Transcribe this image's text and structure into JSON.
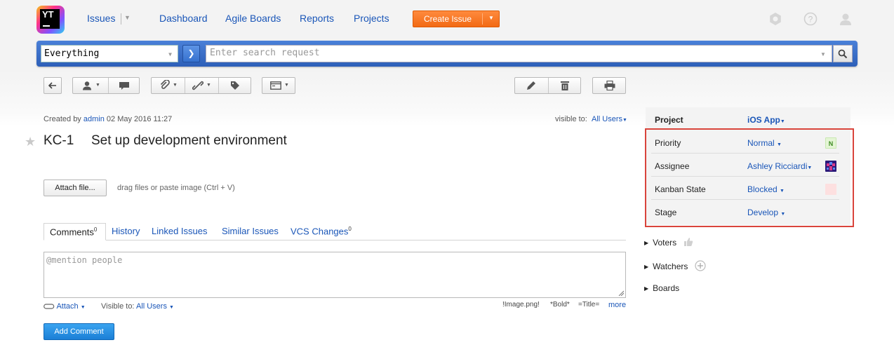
{
  "header": {
    "logo_text": "YT",
    "nav": {
      "issues": "Issues",
      "dashboard": "Dashboard",
      "agile_boards": "Agile Boards",
      "reports": "Reports",
      "projects": "Projects"
    },
    "create_issue": "Create Issue",
    "icons": [
      "settings-icon",
      "help-icon",
      "user-icon"
    ],
    "accent_color": "#f26a14"
  },
  "search": {
    "context": "Everything",
    "placeholder": "Enter search request",
    "bar_color": "#3a6fc8"
  },
  "issue": {
    "created_by_prefix": "Created by",
    "author": "admin",
    "created_at": "02 May 2016 11:27",
    "visible_to_label": "visible to:",
    "visible_to_value": "All Users",
    "id": "KC-1",
    "summary": "Set up development environment"
  },
  "attachments": {
    "button_label": "Attach file...",
    "hint": "drag files or paste image (Ctrl + V)"
  },
  "tabs": [
    {
      "label": "Comments",
      "count": "0"
    },
    {
      "label": "History"
    },
    {
      "label": "Linked Issues"
    },
    {
      "label": "Similar Issues"
    },
    {
      "label": "VCS Changes",
      "count": "0"
    }
  ],
  "comment": {
    "placeholder": "@mention people",
    "attach": "Attach",
    "visible_to_label": "Visible to:",
    "visible_to_value": "All Users",
    "hint_image": "!Image.png!",
    "hint_bold": "*Bold*",
    "hint_title": "=Title=",
    "more": "more",
    "submit": "Add Comment"
  },
  "fields": {
    "project": {
      "name": "Project",
      "value": "iOS App"
    },
    "priority": {
      "name": "Priority",
      "value": "Normal",
      "badge": "N",
      "badge_color": "#e4f5d5"
    },
    "assignee": {
      "name": "Assignee",
      "value": "Ashley Ricciardi"
    },
    "kanban_state": {
      "name": "Kanban State",
      "value": "Blocked",
      "badge_color": "#fde0e0"
    },
    "stage": {
      "name": "Stage",
      "value": "Develop"
    }
  },
  "sections": {
    "voters": "Voters",
    "watchers": "Watchers",
    "boards": "Boards"
  }
}
